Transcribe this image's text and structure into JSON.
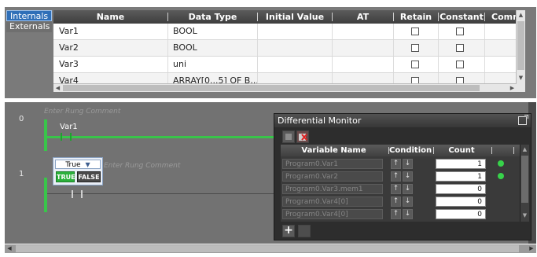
{
  "side_tabs": [
    {
      "label": "Internals",
      "active": true
    },
    {
      "label": "Externals",
      "active": false
    }
  ],
  "var_table": {
    "columns": [
      "Name",
      "Data Type",
      "Initial Value",
      "AT",
      "Retain",
      "Constant",
      "Comm"
    ],
    "rows": [
      {
        "name": "Var1",
        "data_type": "BOOL",
        "initial_value": "",
        "at": "",
        "retain": false,
        "constant": false
      },
      {
        "name": "Var2",
        "data_type": "BOOL",
        "initial_value": "",
        "at": "",
        "retain": false,
        "constant": false
      },
      {
        "name": "Var3",
        "data_type": "uni",
        "initial_value": "",
        "at": "",
        "retain": false,
        "constant": false
      },
      {
        "name": "Var4",
        "data_type": "ARRAY[0...5] OF B...",
        "initial_value": "",
        "at": "",
        "retain": false,
        "constant": false
      }
    ]
  },
  "ladder": {
    "rungs": [
      {
        "number": "0",
        "comment": "Enter Rung Comment",
        "contact_label": "Var1"
      },
      {
        "number": "1",
        "comment": "Enter Rung Comment",
        "contact_label": ""
      }
    ],
    "true_false_popup": {
      "selected": "True",
      "true_label": "TRUE",
      "false_label": "FALSE"
    }
  },
  "diff_monitor": {
    "title": "Differential Monitor",
    "columns": [
      "Variable Name",
      "Condition",
      "Count"
    ],
    "rows": [
      {
        "name": "Program0.Var1",
        "count": "1",
        "led": true
      },
      {
        "name": "Program0.Var2",
        "count": "1",
        "led": true
      },
      {
        "name": "Program0.Var3.mem1",
        "count": "0",
        "led": false
      },
      {
        "name": "Program0.Var4[0]",
        "count": "0",
        "led": false
      },
      {
        "name": "Program0.Var4[0]",
        "count": "0",
        "led": false
      }
    ],
    "add_label": "+",
    "colors": {
      "led_on": "#37d24a",
      "rail_green": "#39c54a"
    }
  }
}
